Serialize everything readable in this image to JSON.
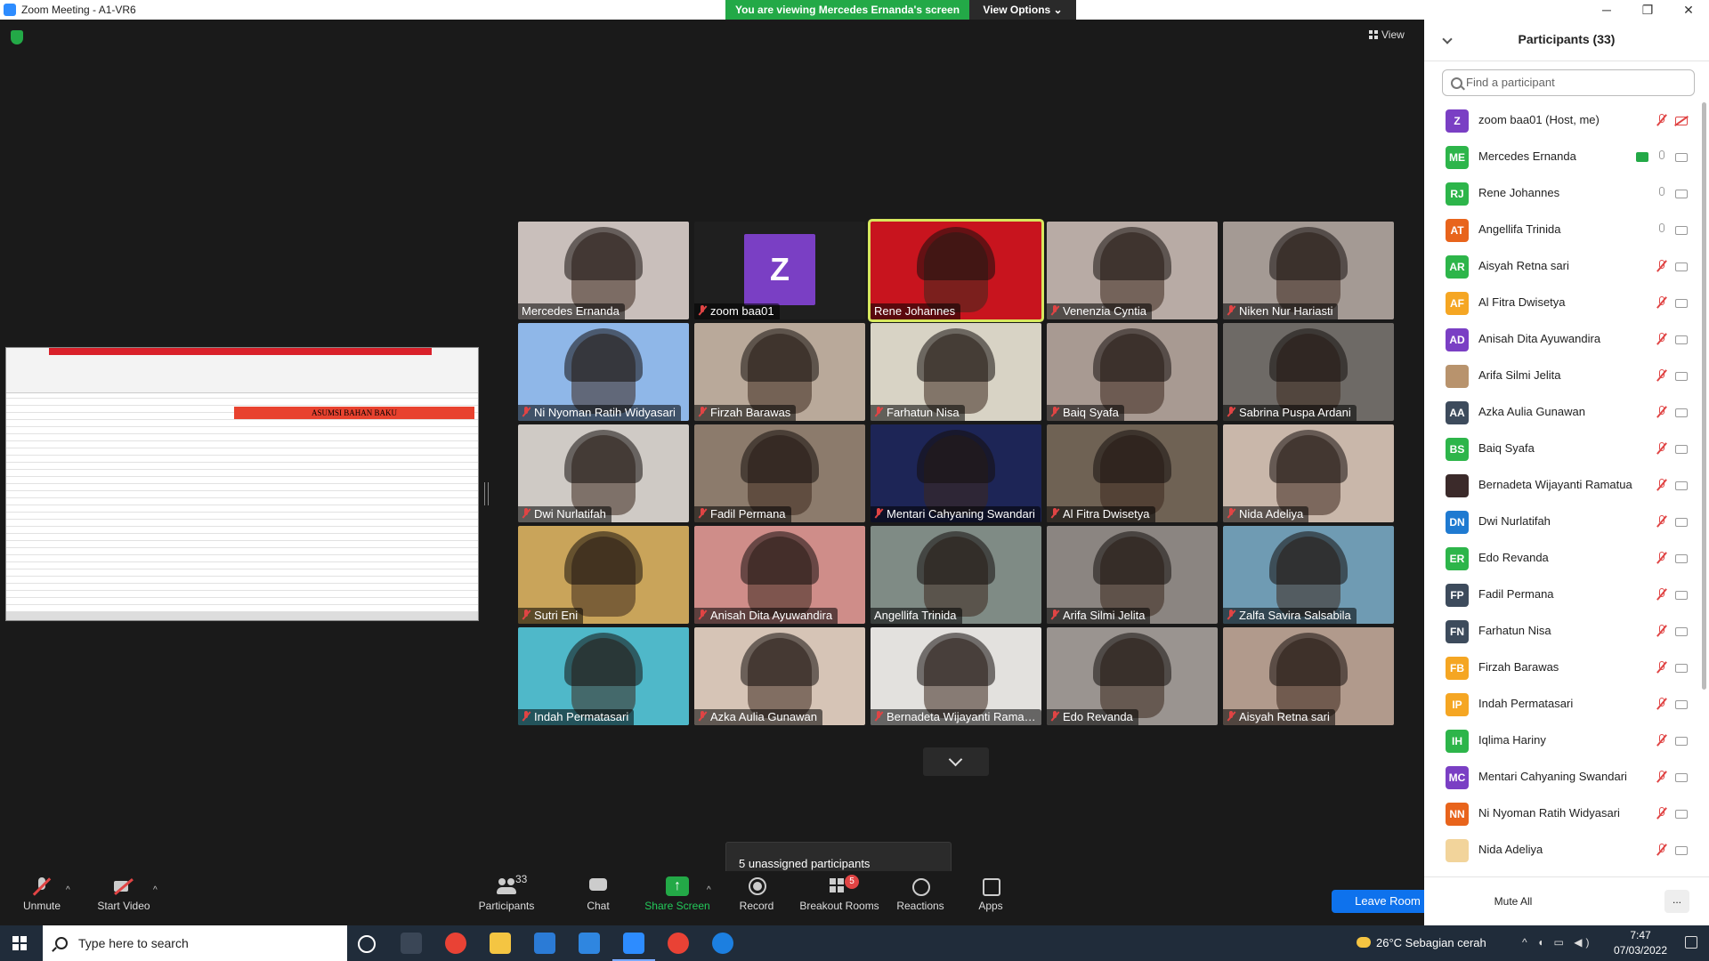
{
  "window": {
    "title": "Zoom Meeting - A1-VR6",
    "minimize": "─",
    "maximize": "❐",
    "close": "✕"
  },
  "banner": {
    "viewing_text": "You are viewing Mercedes Ernanda's screen",
    "view_options": "View Options ⌄"
  },
  "top": {
    "view_label": "View"
  },
  "shared_screen": {
    "sheet_title": "ASUMSI BAHAN BAKU"
  },
  "tiles": [
    {
      "name": "Mercedes Ernanda",
      "muted": false,
      "bg": "#c9bfbb"
    },
    {
      "name": "zoom baa01",
      "muted": true,
      "bg": "#1f1f1f",
      "avatar": "Z"
    },
    {
      "name": "Rene Johannes",
      "muted": false,
      "bg": "#c8141e",
      "active": true
    },
    {
      "name": "Venenzia Cyntia",
      "muted": true,
      "bg": "#b8aba5"
    },
    {
      "name": "Niken Nur Hariasti",
      "muted": true,
      "bg": "#a49a94"
    },
    {
      "name": "Ni Nyoman Ratih Widyasari",
      "muted": true,
      "bg": "#8fb7e8"
    },
    {
      "name": "Firzah Barawas",
      "muted": true,
      "bg": "#b9a99a"
    },
    {
      "name": "Farhatun Nisa",
      "muted": true,
      "bg": "#d8d3c5"
    },
    {
      "name": "Baiq Syafa",
      "muted": true,
      "bg": "#a89a92"
    },
    {
      "name": "Sabrina Puspa Ardani",
      "muted": true,
      "bg": "#6e6a66"
    },
    {
      "name": "Dwi Nurlatifah",
      "muted": true,
      "bg": "#cfcac5"
    },
    {
      "name": "Fadil Permana",
      "muted": true,
      "bg": "#8c7b6c"
    },
    {
      "name": "Mentari Cahyaning Swandari",
      "muted": true,
      "bg": "#1d2556"
    },
    {
      "name": "Al Fitra Dwisetya",
      "muted": true,
      "bg": "#6f6254"
    },
    {
      "name": "Nida Adeliya",
      "muted": true,
      "bg": "#c9b7aa"
    },
    {
      "name": "Sutri Eni",
      "muted": true,
      "bg": "#c9a45a"
    },
    {
      "name": "Anisah Dita Ayuwandira",
      "muted": true,
      "bg": "#cf8d89"
    },
    {
      "name": "Angellifa Trinida",
      "muted": false,
      "bg": "#7f8b85"
    },
    {
      "name": "Arifa Silmi Jelita",
      "muted": true,
      "bg": "#8b8581"
    },
    {
      "name": "Zalfa Savira Salsabila",
      "muted": true,
      "bg": "#6f9bb3"
    },
    {
      "name": "Indah Permatasari",
      "muted": true,
      "bg": "#4fb8c9"
    },
    {
      "name": "Azka Aulia Gunawan",
      "muted": true,
      "bg": "#d6c4b6"
    },
    {
      "name": "Bernadeta Wijayanti Ramatua",
      "muted": true,
      "bg": "#e3e1de"
    },
    {
      "name": "Edo Revanda",
      "muted": true,
      "bg": "#9a9490"
    },
    {
      "name": "Aisyah Retna sari",
      "muted": true,
      "bg": "#b19a8c"
    }
  ],
  "unassigned_text": "5 unassigned participants",
  "toolbar": {
    "unmute": "Unmute",
    "start_video": "Start Video",
    "participants": "Participants",
    "participants_count": "33",
    "chat": "Chat",
    "share_screen": "Share Screen",
    "record": "Record",
    "breakout_rooms": "Breakout Rooms",
    "breakout_badge": "5",
    "reactions": "Reactions",
    "apps": "Apps",
    "leave_room": "Leave Room",
    "caret": "^"
  },
  "panel": {
    "title": "Participants (33)",
    "search_placeholder": "Find a participant",
    "mute_all": "Mute All",
    "more": "...",
    "participants": [
      {
        "initials": "Z",
        "name": "zoom baa01 (Host, me)",
        "color": "#7a3fc4",
        "mic": "off",
        "cam": "off"
      },
      {
        "initials": "ME",
        "name": "Mercedes Ernanda",
        "color": "#2db54a",
        "mic": "on",
        "cam": "on",
        "sharing": true
      },
      {
        "initials": "RJ",
        "name": "Rene Johannes",
        "color": "#2db54a",
        "mic": "on",
        "cam": "on"
      },
      {
        "initials": "AT",
        "name": "Angellifa Trinida",
        "color": "#e8641c",
        "mic": "on",
        "cam": "on"
      },
      {
        "initials": "AR",
        "name": "Aisyah Retna sari",
        "color": "#2db54a",
        "mic": "off",
        "cam": "on"
      },
      {
        "initials": "AF",
        "name": "Al Fitra Dwisetya",
        "color": "#f5a623",
        "mic": "off",
        "cam": "on"
      },
      {
        "initials": "AD",
        "name": "Anisah Dita Ayuwandira",
        "color": "#7a3fc4",
        "mic": "off",
        "cam": "on"
      },
      {
        "initials": "",
        "name": "Arifa Silmi Jelita",
        "color": "#b8936d",
        "mic": "off",
        "cam": "on"
      },
      {
        "initials": "AA",
        "name": "Azka Aulia Gunawan",
        "color": "#3d4b5c",
        "mic": "off",
        "cam": "on"
      },
      {
        "initials": "BS",
        "name": "Baiq Syafa",
        "color": "#2db54a",
        "mic": "off",
        "cam": "on"
      },
      {
        "initials": "",
        "name": "Bernadeta Wijayanti Ramatua",
        "color": "#3b2a2a",
        "mic": "off",
        "cam": "on"
      },
      {
        "initials": "DN",
        "name": "Dwi Nurlatifah",
        "color": "#1f7ad1",
        "mic": "off",
        "cam": "on"
      },
      {
        "initials": "ER",
        "name": "Edo Revanda",
        "color": "#2db54a",
        "mic": "off",
        "cam": "on"
      },
      {
        "initials": "FP",
        "name": "Fadil Permana",
        "color": "#3d4b5c",
        "mic": "off",
        "cam": "on"
      },
      {
        "initials": "FN",
        "name": "Farhatun Nisa",
        "color": "#3d4b5c",
        "mic": "off",
        "cam": "on"
      },
      {
        "initials": "FB",
        "name": "Firzah Barawas",
        "color": "#f5a623",
        "mic": "off",
        "cam": "on"
      },
      {
        "initials": "IP",
        "name": "Indah Permatasari",
        "color": "#f5a623",
        "mic": "off",
        "cam": "on"
      },
      {
        "initials": "IH",
        "name": "Iqlima Hariny",
        "color": "#2db54a",
        "mic": "off",
        "cam": "on"
      },
      {
        "initials": "MC",
        "name": "Mentari Cahyaning Swandari",
        "color": "#7a3fc4",
        "mic": "off",
        "cam": "on"
      },
      {
        "initials": "NN",
        "name": "Ni Nyoman Ratih Widyasari",
        "color": "#e8641c",
        "mic": "off",
        "cam": "on"
      },
      {
        "initials": "",
        "name": "Nida Adeliya",
        "color": "#f2d49b",
        "mic": "off",
        "cam": "on"
      }
    ]
  },
  "taskbar": {
    "search_placeholder": "Type here to search",
    "weather": "26°C  Sebagian cerah",
    "tray": "^ ◖ ▭ ◀)",
    "time": "7:47",
    "date": "07/03/2022"
  }
}
